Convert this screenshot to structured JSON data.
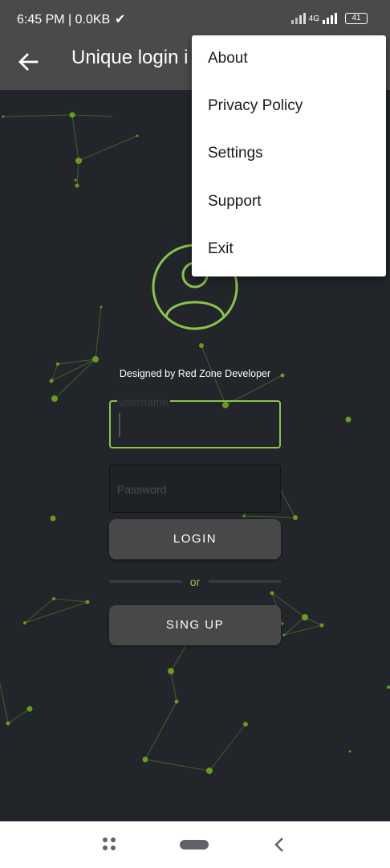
{
  "status_bar": {
    "time_speed": "6:45 PM | 0.0KB",
    "network_label": "4G",
    "battery": "41"
  },
  "app_bar": {
    "title": "Unique login i"
  },
  "login": {
    "credit": "Designed by Red Zone Developer",
    "username_label": "username",
    "password_placeholder": "Password",
    "login_button": "LOGIN",
    "or_text": "or",
    "signup_button": "SING UP"
  },
  "menu": {
    "items": [
      "About",
      "Privacy Policy",
      "Settings",
      "Support",
      "Exit"
    ]
  },
  "colors": {
    "accent": "#8bc34a",
    "background": "#22252a",
    "bar": "#4a4a4a"
  },
  "icons": {
    "back": "arrow-left-icon",
    "avatar": "user-circle-icon",
    "recents": "recents-icon",
    "home": "home-pill-icon",
    "nav_back": "chevron-left-icon"
  }
}
